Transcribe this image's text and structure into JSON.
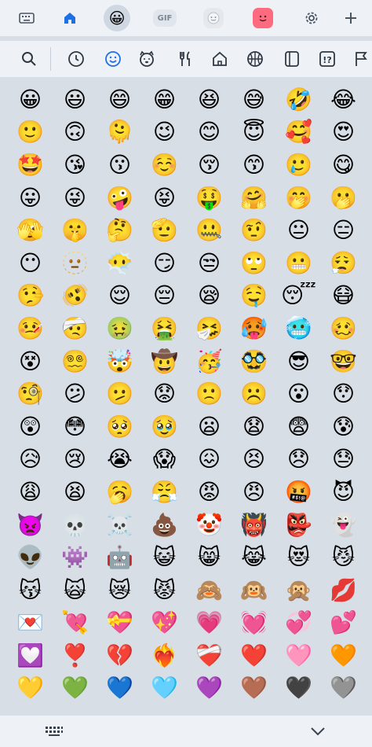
{
  "topbar": {
    "tabs": [
      {
        "name": "keyboard-icon"
      },
      {
        "name": "home-icon",
        "accent": "#1f6fe5"
      },
      {
        "name": "emoji-icon",
        "active": true
      },
      {
        "name": "gif-icon",
        "label": "GIF"
      },
      {
        "name": "sticker-icon"
      },
      {
        "name": "bitmoji-icon"
      },
      {
        "name": "gear-icon"
      },
      {
        "name": "plus-icon"
      }
    ]
  },
  "categories": [
    {
      "name": "search-icon"
    },
    {
      "name": "recent-clock-icon"
    },
    {
      "name": "smileys-icon",
      "active": true,
      "accent": "#1f6fe5"
    },
    {
      "name": "animals-icon"
    },
    {
      "name": "food-icon"
    },
    {
      "name": "places-icon"
    },
    {
      "name": "activities-icon"
    },
    {
      "name": "objects-icon"
    },
    {
      "name": "symbols-icon"
    },
    {
      "name": "flags-icon"
    }
  ],
  "emoji_rows": [
    [
      "😀",
      "😃",
      "😄",
      "😁",
      "😆",
      "😅",
      "🤣",
      "😂"
    ],
    [
      "🙂",
      "🙃",
      "🫠",
      "😉",
      "😊",
      "😇",
      "🥰",
      "😍"
    ],
    [
      "🤩",
      "😘",
      "😗",
      "☺️",
      "😚",
      "😙",
      "🥲",
      "😋"
    ],
    [
      "😛",
      "😜",
      "🤪",
      "😝",
      "🤑",
      "🤗",
      "🤭",
      "🫢"
    ],
    [
      "🫣",
      "🤫",
      "🤔",
      "🫡",
      "🤐",
      "🤨",
      "😐",
      "😑"
    ],
    [
      "😶",
      "🫥",
      "😶‍🌫️",
      "😏",
      "😒",
      "🙄",
      "😬",
      "😮‍💨"
    ],
    [
      "🤥",
      "🫨",
      "😌",
      "😔",
      "😪",
      "🤤",
      "😴",
      "😷"
    ],
    [
      "🤒",
      "🤕",
      "🤢",
      "🤮",
      "🤧",
      "🥵",
      "🥶",
      "🥴"
    ],
    [
      "😵",
      "😵‍💫",
      "🤯",
      "🤠",
      "🥳",
      "🥸",
      "😎",
      "🤓"
    ],
    [
      "🧐",
      "😕",
      "🫤",
      "😟",
      "🙁",
      "☹️",
      "😮",
      "😯"
    ],
    [
      "😲",
      "😳",
      "🥺",
      "🥹",
      "😦",
      "😧",
      "😨",
      "😰"
    ],
    [
      "😥",
      "😢",
      "😭",
      "😱",
      "😖",
      "😣",
      "😞",
      "😓"
    ],
    [
      "😩",
      "😫",
      "🥱",
      "😤",
      "😡",
      "😠",
      "🤬",
      "😈"
    ],
    [
      "👿",
      "💀",
      "☠️",
      "💩",
      "🤡",
      "👹",
      "👺",
      "👻"
    ],
    [
      "👽",
      "👾",
      "🤖",
      "😺",
      "😸",
      "😹",
      "😻",
      "😼"
    ],
    [
      "😽",
      "🙀",
      "😿",
      "😾",
      "🙈",
      "🙉",
      "🙊",
      "💋"
    ],
    [
      "💌",
      "💘",
      "💝",
      "💖",
      "💗",
      "💓",
      "💞",
      "💕"
    ],
    [
      "💟",
      "❣️",
      "💔",
      "❤️‍🔥",
      "❤️‍🩹",
      "❤️",
      "🩷",
      "🧡"
    ],
    [
      "💛",
      "💚",
      "💙",
      "🩵",
      "💜",
      "🤎",
      "🖤",
      "🩶"
    ]
  ],
  "bottombar": {
    "left": {
      "name": "keyboard-icon"
    },
    "right": {
      "name": "chevron-down-icon"
    }
  }
}
